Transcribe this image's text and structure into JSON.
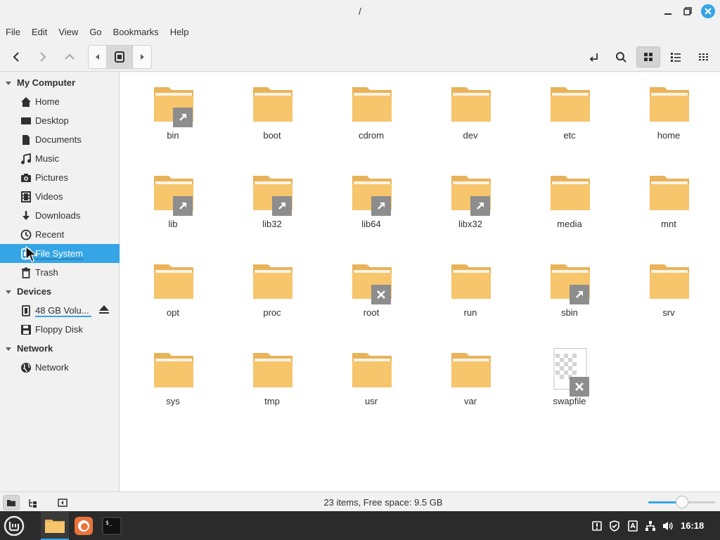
{
  "window": {
    "title": "/"
  },
  "menubar": [
    "File",
    "Edit",
    "View",
    "Go",
    "Bookmarks",
    "Help"
  ],
  "sidebar": {
    "sections": [
      {
        "label": "My Computer",
        "items": [
          {
            "label": "Home",
            "icon": "home-icon"
          },
          {
            "label": "Desktop",
            "icon": "desktop-icon"
          },
          {
            "label": "Documents",
            "icon": "document-icon"
          },
          {
            "label": "Music",
            "icon": "music-icon"
          },
          {
            "label": "Pictures",
            "icon": "camera-icon"
          },
          {
            "label": "Videos",
            "icon": "film-icon"
          },
          {
            "label": "Downloads",
            "icon": "download-icon"
          },
          {
            "label": "Recent",
            "icon": "clock-icon"
          },
          {
            "label": "File System",
            "icon": "drive-icon",
            "selected": true
          },
          {
            "label": "Trash",
            "icon": "trash-icon"
          }
        ]
      },
      {
        "label": "Devices",
        "items": [
          {
            "label": "48 GB Volu...",
            "icon": "chip-icon",
            "eject": true
          },
          {
            "label": "Floppy Disk",
            "icon": "floppy-icon"
          }
        ]
      },
      {
        "label": "Network",
        "items": [
          {
            "label": "Network",
            "icon": "globe-icon"
          }
        ]
      }
    ]
  },
  "files": [
    {
      "name": "bin",
      "type": "folder",
      "badge": "link"
    },
    {
      "name": "boot",
      "type": "folder",
      "badge": ""
    },
    {
      "name": "cdrom",
      "type": "folder",
      "badge": ""
    },
    {
      "name": "dev",
      "type": "folder",
      "badge": ""
    },
    {
      "name": "etc",
      "type": "folder",
      "badge": ""
    },
    {
      "name": "home",
      "type": "folder",
      "badge": ""
    },
    {
      "name": "lib",
      "type": "folder",
      "badge": "link"
    },
    {
      "name": "lib32",
      "type": "folder",
      "badge": "link"
    },
    {
      "name": "lib64",
      "type": "folder",
      "badge": "link"
    },
    {
      "name": "libx32",
      "type": "folder",
      "badge": "link"
    },
    {
      "name": "media",
      "type": "folder",
      "badge": ""
    },
    {
      "name": "mnt",
      "type": "folder",
      "badge": ""
    },
    {
      "name": "opt",
      "type": "folder",
      "badge": ""
    },
    {
      "name": "proc",
      "type": "folder",
      "badge": ""
    },
    {
      "name": "root",
      "type": "folder",
      "badge": "locked"
    },
    {
      "name": "run",
      "type": "folder",
      "badge": ""
    },
    {
      "name": "sbin",
      "type": "folder",
      "badge": "link"
    },
    {
      "name": "srv",
      "type": "folder",
      "badge": ""
    },
    {
      "name": "sys",
      "type": "folder",
      "badge": ""
    },
    {
      "name": "tmp",
      "type": "folder",
      "badge": ""
    },
    {
      "name": "usr",
      "type": "folder",
      "badge": ""
    },
    {
      "name": "var",
      "type": "folder",
      "badge": ""
    },
    {
      "name": "swapfile",
      "type": "file",
      "badge": "locked"
    }
  ],
  "statusbar": {
    "text": "23 items, Free space: 9.5 GB",
    "zoom_level": 0.5
  },
  "taskbar": {
    "clock": "16:18"
  },
  "colors": {
    "accent": "#35a5e5",
    "folder": "#f6c56c",
    "folder_tab": "#e9b35a"
  }
}
